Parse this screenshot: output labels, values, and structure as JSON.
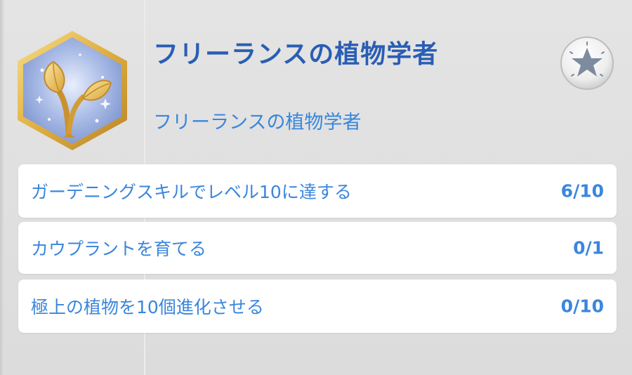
{
  "aspiration": {
    "title": "フリーランスの植物学者",
    "subtitle": "フリーランスの植物学者",
    "badge_icon": "sprout-icon",
    "star_icon": "star-icon"
  },
  "goals": [
    {
      "label": "ガーデニングスキルでレベル10に達する",
      "progress": "6/10"
    },
    {
      "label": "カウプラントを育てる",
      "progress": "0/1"
    },
    {
      "label": "極上の植物を10個進化させる",
      "progress": "0/10"
    }
  ],
  "colors": {
    "title": "#2a5eb4",
    "text": "#3a86dc",
    "badge_gold": "#e2b84a",
    "badge_blue": "#9fb3dd"
  }
}
